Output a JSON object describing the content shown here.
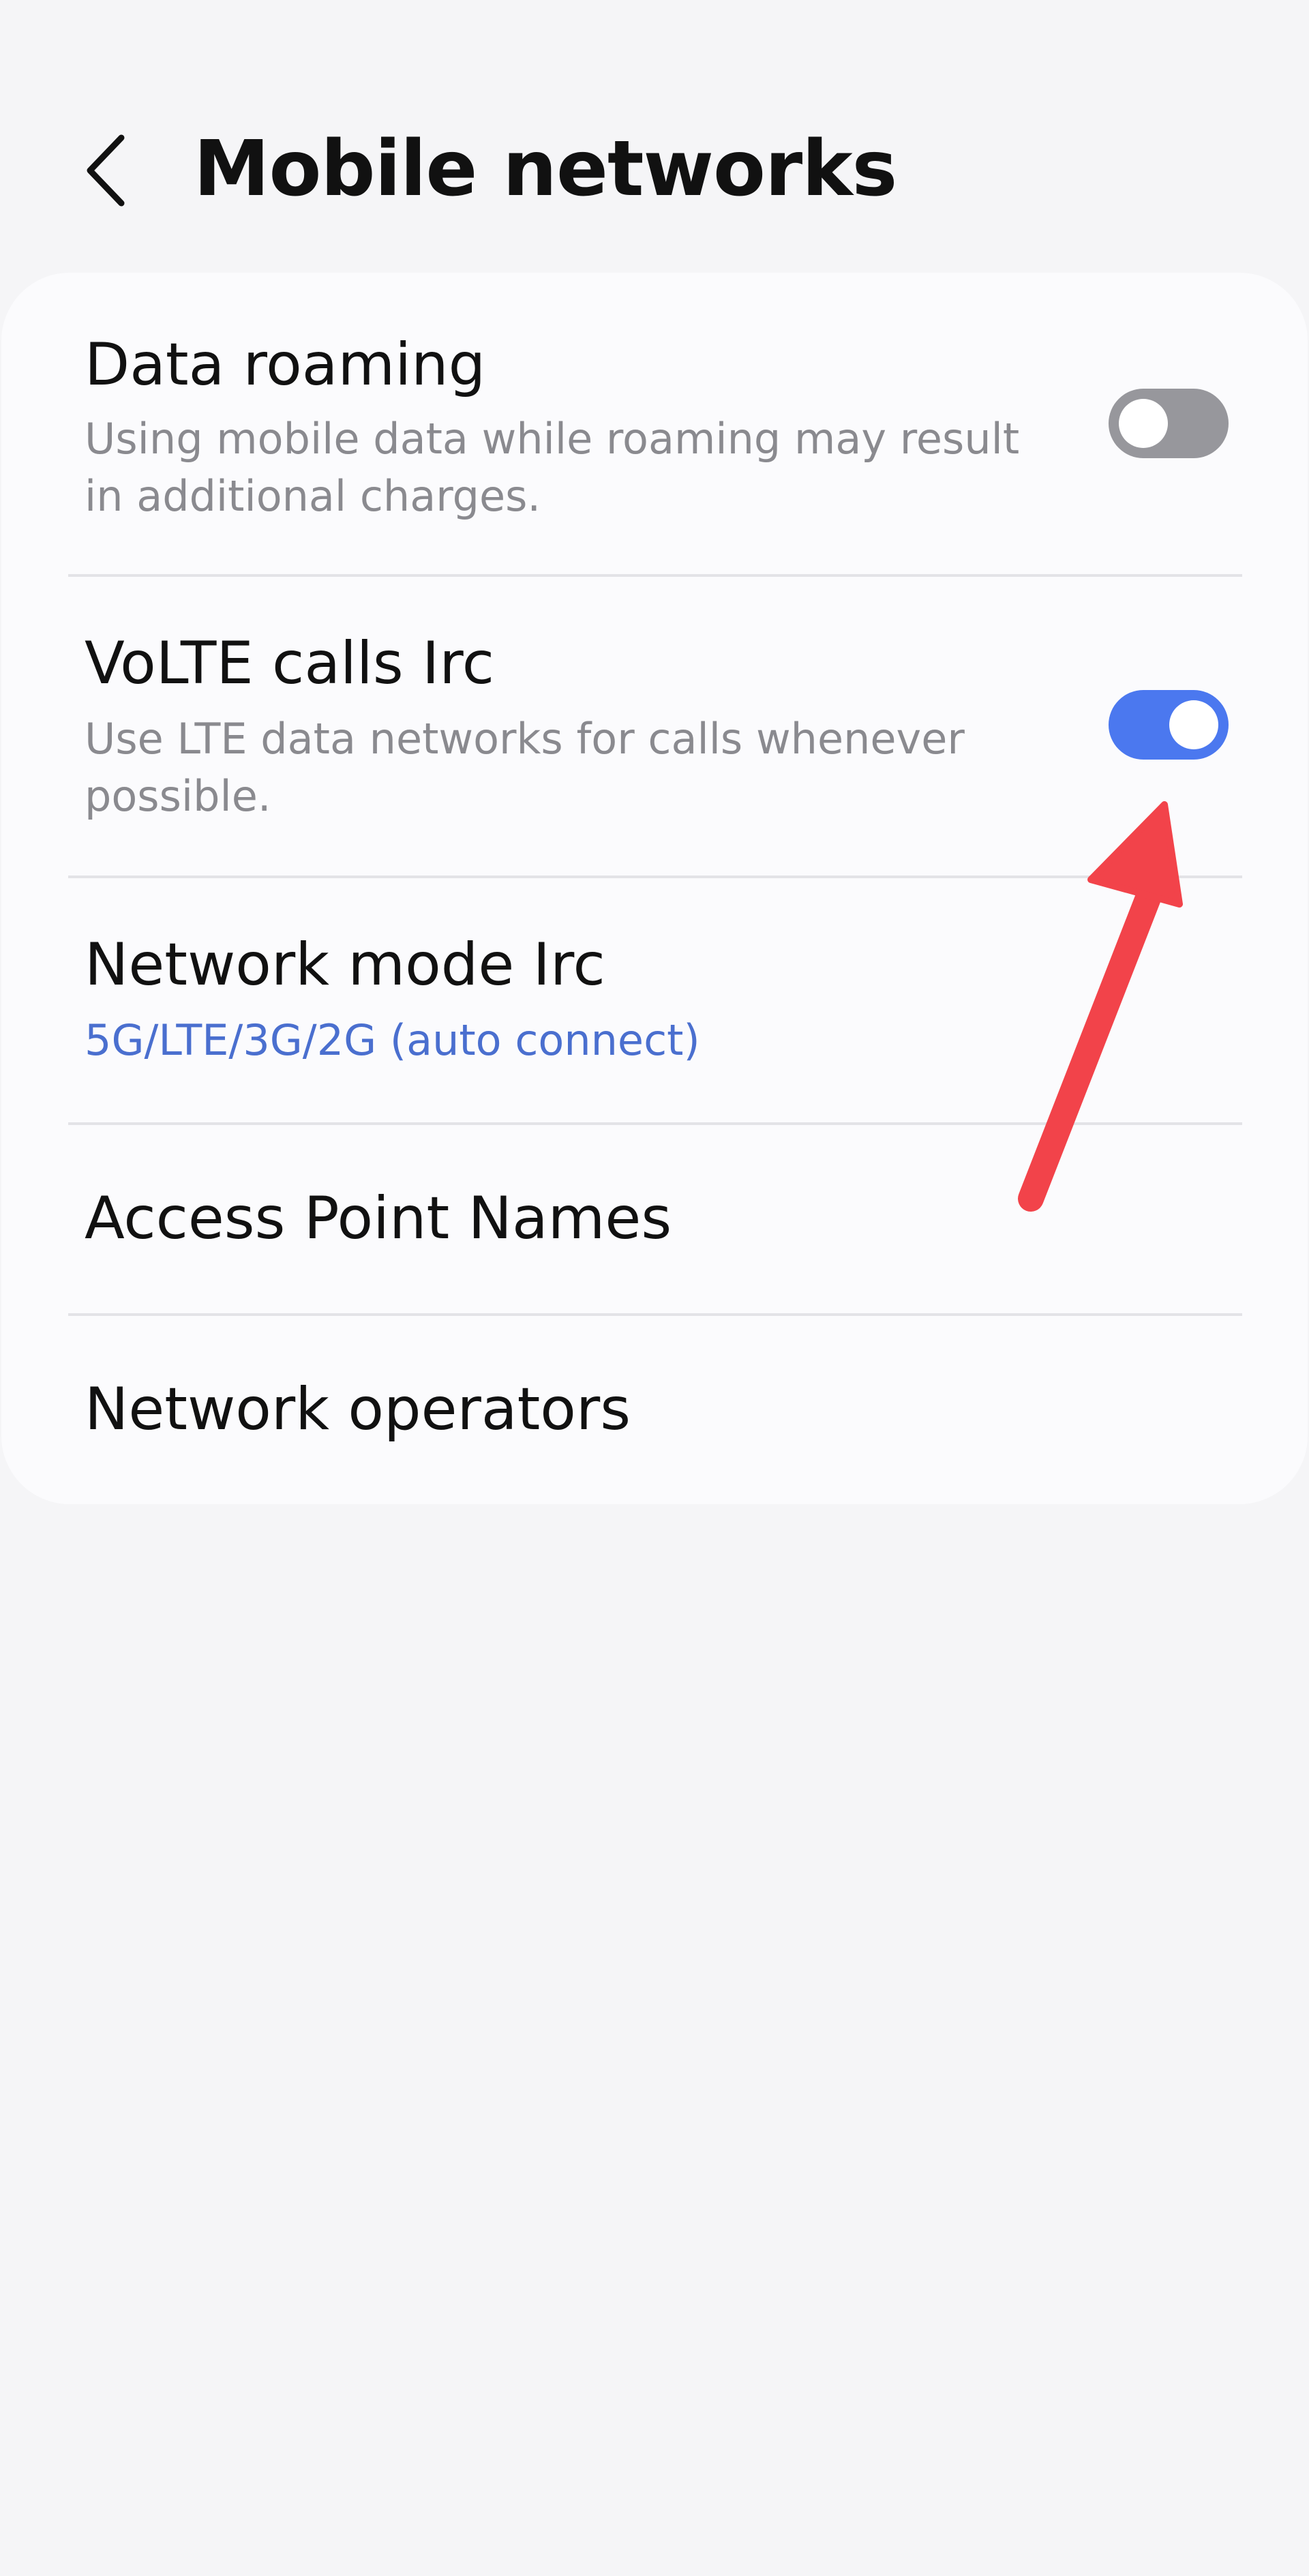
{
  "header": {
    "title": "Mobile networks",
    "back_icon": "chevron-left-icon"
  },
  "settings": {
    "data_roaming": {
      "title": "Data roaming",
      "subtitle": "Using mobile data while roaming may result in additional charges.",
      "enabled": false
    },
    "volte_calls": {
      "title": "VoLTE calls Irc",
      "subtitle": "Use LTE data networks for calls whenever possible.",
      "enabled": true
    },
    "network_mode": {
      "title": "Network mode Irc",
      "value": "5G/LTE/3G/2G (auto connect)"
    },
    "access_point_names": {
      "title": "Access Point Names"
    },
    "network_operators": {
      "title": "Network operators"
    }
  },
  "colors": {
    "background": "#f5f5f7",
    "card": "#fbfbfd",
    "toggle_on": "#4b78ef",
    "toggle_off": "#97979c",
    "link": "#4a6fcf",
    "annotation_arrow": "#f2434a"
  }
}
